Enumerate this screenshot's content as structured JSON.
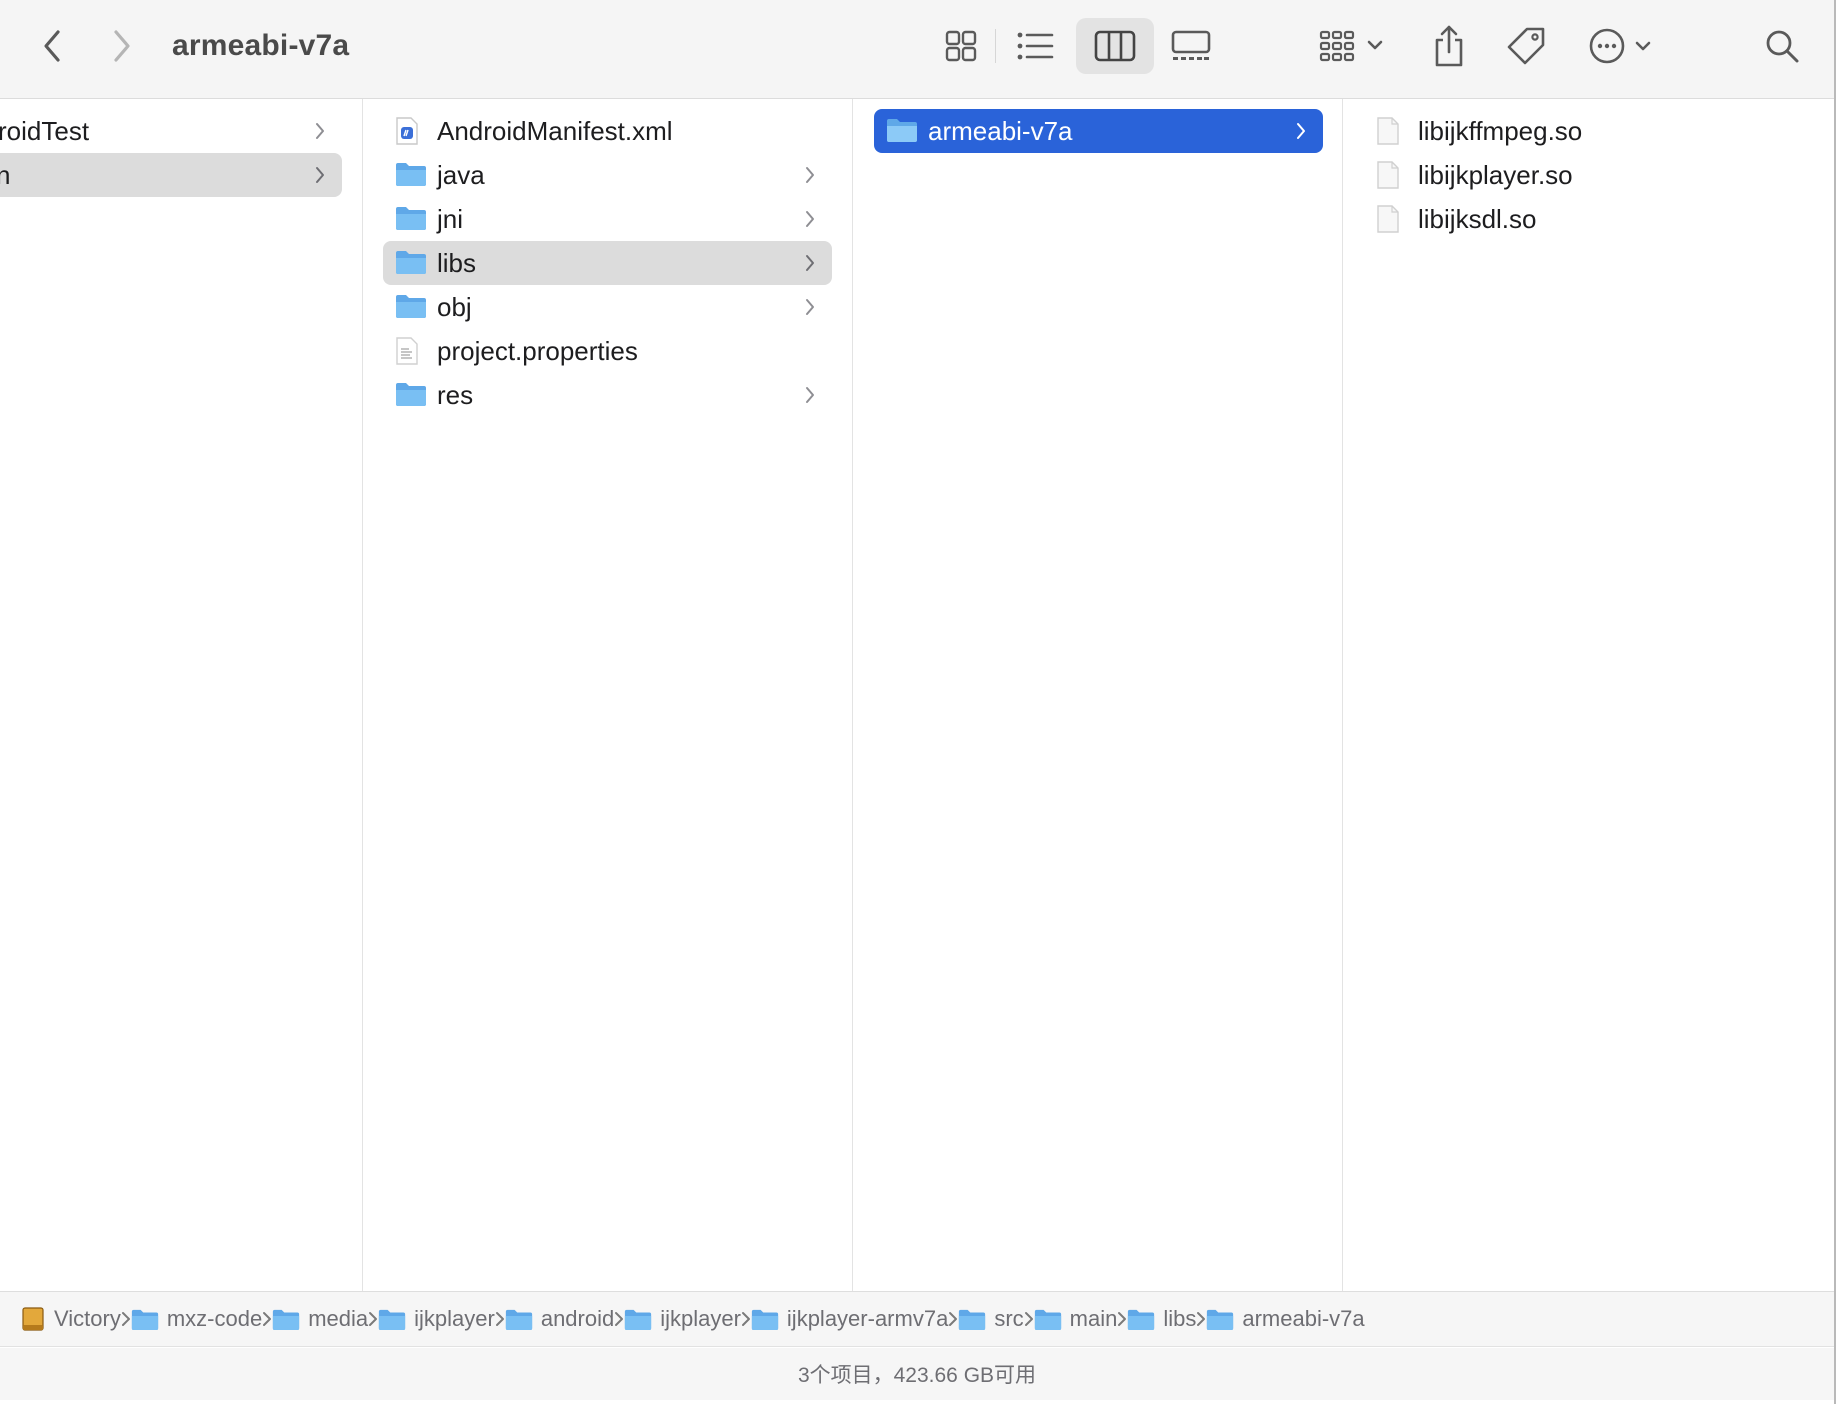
{
  "window": {
    "title": "armeabi-v7a"
  },
  "toolbar": {
    "back": "chevron-left-icon",
    "forward": "chevron-right-icon",
    "view_buttons": [
      "icon-view",
      "list-view",
      "column-view",
      "gallery-view"
    ],
    "active_view": "column-view",
    "group": "group-by-icon",
    "share": "share-icon",
    "tag": "tag-icon",
    "more": "ellipsis-circle-icon",
    "search": "search-icon"
  },
  "columns": {
    "col1": [
      {
        "name": "roidTest",
        "type": "folder",
        "chevron": true
      },
      {
        "name": "n",
        "type": "folder",
        "chevron": true,
        "selected": true
      }
    ],
    "col2": [
      {
        "name": "AndroidManifest.xml",
        "type": "xml",
        "chevron": false
      },
      {
        "name": "java",
        "type": "folder",
        "chevron": true
      },
      {
        "name": "jni",
        "type": "folder",
        "chevron": true
      },
      {
        "name": "libs",
        "type": "folder",
        "chevron": true,
        "selected": true
      },
      {
        "name": "obj",
        "type": "folder",
        "chevron": true
      },
      {
        "name": "project.properties",
        "type": "text",
        "chevron": false
      },
      {
        "name": "res",
        "type": "folder",
        "chevron": true
      }
    ],
    "col3": [
      {
        "name": "armeabi-v7a",
        "type": "folder",
        "chevron": true,
        "active": true
      }
    ],
    "col4": [
      {
        "name": "libijkffmpeg.so",
        "type": "file"
      },
      {
        "name": "libijkplayer.so",
        "type": "file"
      },
      {
        "name": "libijksdl.so",
        "type": "file"
      }
    ]
  },
  "pathbar": [
    {
      "name": "Victory",
      "type": "disk"
    },
    {
      "name": "mxz-code",
      "type": "folder"
    },
    {
      "name": "media",
      "type": "folder"
    },
    {
      "name": "ijkplayer",
      "type": "folder"
    },
    {
      "name": "android",
      "type": "folder"
    },
    {
      "name": "ijkplayer",
      "type": "folder"
    },
    {
      "name": "ijkplayer-armv7a",
      "type": "folder"
    },
    {
      "name": "src",
      "type": "folder"
    },
    {
      "name": "main",
      "type": "folder"
    },
    {
      "name": "libs",
      "type": "folder"
    },
    {
      "name": "armeabi-v7a",
      "type": "folder"
    }
  ],
  "status": {
    "text": "3个项目，423.66 GB可用"
  },
  "colors": {
    "selection_blue": "#2a63d9",
    "selection_grey": "#dcdcdc",
    "folder_blue": "#6fb6ef"
  }
}
